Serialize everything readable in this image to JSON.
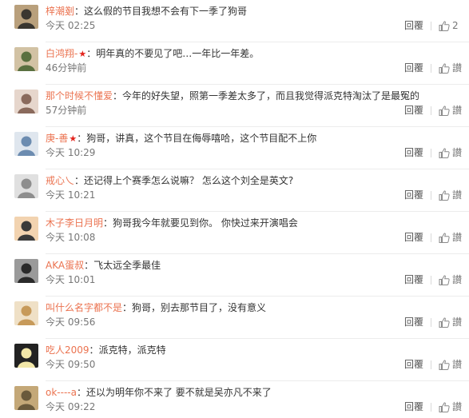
{
  "comments": [
    {
      "username": "梓潮剗",
      "vip": false,
      "text": "这么假的节目我想不会有下一季了狗哥",
      "time": "今天 02:25",
      "reply_label": "回覆",
      "like_label": "2",
      "avatar_icon": "avatar-dark-portrait",
      "avatar_colors": [
        "#3a3630",
        "#b9a07c"
      ]
    },
    {
      "username": "白鸿翔-",
      "vip": true,
      "text": "明年真的不要见了吧…一年比一年差。",
      "time": "46分钟前",
      "reply_label": "回覆",
      "like_label": "讃",
      "avatar_icon": "avatar-landscape",
      "avatar_colors": [
        "#5a7040",
        "#d2c2a4"
      ]
    },
    {
      "username": "那个时候不懂爱",
      "vip": false,
      "text": "今年的好失望，照第一季差太多了，而且我觉得派克特淘汰了是最冤的",
      "time": "57分钟前",
      "reply_label": "回覆",
      "like_label": "讃",
      "avatar_icon": "avatar-girl-photo",
      "avatar_colors": [
        "#8a6a5c",
        "#e6d6cc"
      ]
    },
    {
      "username": "庚-善",
      "vip": true,
      "text": "狗哥，讲真，这个节目在侮辱嘻哈，这个节目配不上你",
      "time": "今天 10:29",
      "reply_label": "回覆",
      "like_label": "讃",
      "avatar_icon": "avatar-mountain-sky",
      "avatar_colors": [
        "#6c8cb0",
        "#dfe6ee"
      ]
    },
    {
      "username": "戒心乀",
      "vip": false,
      "text": "还记得上个赛季怎么说嘛？ 怎么这个刘全是英文?",
      "time": "今天 10:21",
      "reply_label": "回覆",
      "like_label": "讃",
      "avatar_icon": "avatar-gray-figure",
      "avatar_colors": [
        "#8e8e8e",
        "#e0e0e0"
      ]
    },
    {
      "username": "木子李日月明",
      "vip": false,
      "text": "狗哥我今年就要见到你。 你快过来开演唱会",
      "time": "今天 10:08",
      "reply_label": "回覆",
      "like_label": "讃",
      "avatar_icon": "avatar-cartoon-face",
      "avatar_colors": [
        "#3a3a3a",
        "#f2d3b0"
      ]
    },
    {
      "username": "AKA蛋叔",
      "vip": false,
      "text": "飞太远全季最佳",
      "time": "今天 10:01",
      "reply_label": "回覆",
      "like_label": "讃",
      "avatar_icon": "avatar-dark-portrait",
      "avatar_colors": [
        "#2a2a2a",
        "#9a9a9a"
      ]
    },
    {
      "username": "叫什么名字都不是",
      "vip": false,
      "text": "狗哥，别去那节目了，没有意义",
      "time": "今天 09:56",
      "reply_label": "回覆",
      "like_label": "讃",
      "avatar_icon": "avatar-warm-portrait",
      "avatar_colors": [
        "#c79a5a",
        "#efe0c6"
      ]
    },
    {
      "username": "吃人2009",
      "vip": false,
      "text": "派克特，派克特",
      "time": "今天 09:50",
      "reply_label": "回覆",
      "like_label": "讃",
      "avatar_icon": "avatar-cartoon-bird",
      "avatar_colors": [
        "#f2e7a8",
        "#222222"
      ]
    },
    {
      "username": "ok----a",
      "vip": false,
      "text": "还以为明年你不来了 要不就是吴亦凡不来了",
      "time": "今天 09:22",
      "reply_label": "回覆",
      "like_label": "讃",
      "avatar_icon": "avatar-corridor-photo",
      "avatar_colors": [
        "#6a5a3c",
        "#c4a878"
      ]
    }
  ],
  "colors": {
    "username": "#eb7350",
    "vip_star": "#e3241d",
    "text": "#333333",
    "meta": "#777777"
  }
}
